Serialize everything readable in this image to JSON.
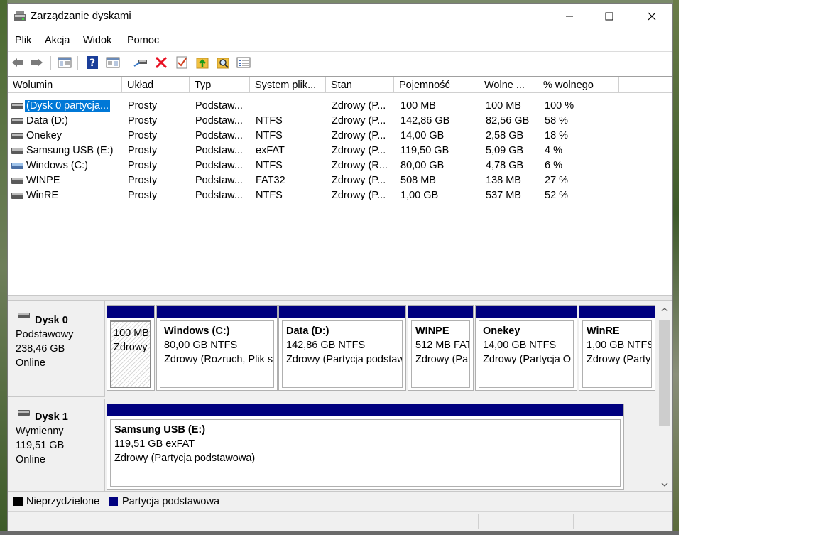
{
  "window": {
    "title": "Zarządzanie dyskami"
  },
  "menu": [
    "Plik",
    "Akcja",
    "Widok",
    "Pomoc"
  ],
  "toolbar": {
    "icons": [
      "back-arrow-icon",
      "forward-arrow-icon",
      "console-tree-icon",
      "help-icon",
      "properties-view-icon",
      "connect-icon",
      "delete-icon",
      "check-icon",
      "open-folder-icon",
      "search-folder-icon",
      "list-view-icon"
    ],
    "colors": {
      "delete": "#e81123",
      "help": "#1a3e9a",
      "folder": "#f0c040"
    }
  },
  "volumes": {
    "columns": [
      "Wolumin",
      "Układ",
      "Typ",
      "System plik...",
      "Stan",
      "Pojemność",
      "Wolne ...",
      "% wolnego"
    ],
    "rows": [
      [
        "(Dysk 0 partycja...",
        "Prosty",
        "Podstaw...",
        "",
        "Zdrowy (P...",
        "100 MB",
        "100 MB",
        "100 %"
      ],
      [
        "Data (D:)",
        "Prosty",
        "Podstaw...",
        "NTFS",
        "Zdrowy (P...",
        "142,86 GB",
        "82,56 GB",
        "58 %"
      ],
      [
        "Onekey",
        "Prosty",
        "Podstaw...",
        "NTFS",
        "Zdrowy (P...",
        "14,00 GB",
        "2,58 GB",
        "18 %"
      ],
      [
        "Samsung USB (E:)",
        "Prosty",
        "Podstaw...",
        "exFAT",
        "Zdrowy (P...",
        "119,50 GB",
        "5,09 GB",
        "4 %"
      ],
      [
        "Windows (C:)",
        "Prosty",
        "Podstaw...",
        "NTFS",
        "Zdrowy (R...",
        "80,00 GB",
        "4,78 GB",
        "6 %"
      ],
      [
        "WINPE",
        "Prosty",
        "Podstaw...",
        "FAT32",
        "Zdrowy (P...",
        "508 MB",
        "138 MB",
        "27 %"
      ],
      [
        "WinRE",
        "Prosty",
        "Podstaw...",
        "NTFS",
        "Zdrowy (P...",
        "1,00 GB",
        "537 MB",
        "52 %"
      ]
    ]
  },
  "disks": [
    {
      "name": "Dysk 0",
      "type": "Podstawowy",
      "size": "238,46 GB",
      "status": "Online",
      "partitions": [
        {
          "name": "",
          "line1": "100 MB",
          "line2": "Zdrowy"
        },
        {
          "name": "Windows  (C:)",
          "line1": "80,00 GB NTFS",
          "line2": "Zdrowy (Rozruch, Plik s"
        },
        {
          "name": "Data  (D:)",
          "line1": "142,86 GB NTFS",
          "line2": "Zdrowy (Partycja podstaw"
        },
        {
          "name": "WINPE",
          "line1": "512 MB FAT",
          "line2": "Zdrowy (Pa"
        },
        {
          "name": "Onekey",
          "line1": "14,00 GB NTFS",
          "line2": "Zdrowy (Partycja O"
        },
        {
          "name": "WinRE",
          "line1": "1,00 GB NTFS",
          "line2": "Zdrowy (Party"
        }
      ]
    },
    {
      "name": "Dysk 1",
      "type": "Wymienny",
      "size": "119,51 GB",
      "status": "Online",
      "partitions": [
        {
          "name": "Samsung USB  (E:)",
          "line1": "119,51 GB exFAT",
          "line2": "Zdrowy (Partycja podstawowa)"
        }
      ]
    }
  ],
  "legend": [
    {
      "label": "Nieprzydzielone",
      "color": "#000000"
    },
    {
      "label": "Partycja podstawowa",
      "color": "#00007f"
    }
  ]
}
